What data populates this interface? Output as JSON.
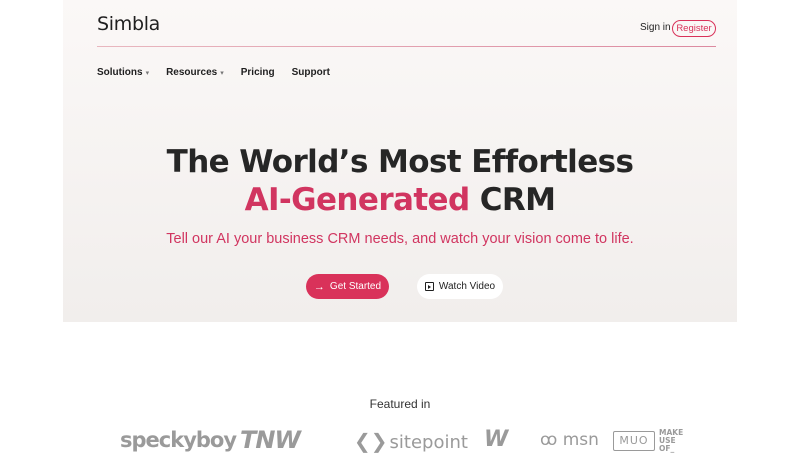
{
  "header": {
    "logo": "Simbla",
    "signin_label": "Sign in",
    "register_label": "Register"
  },
  "nav": {
    "items": [
      {
        "label": "Solutions",
        "has_dropdown": true
      },
      {
        "label": "Resources",
        "has_dropdown": true
      },
      {
        "label": "Pricing",
        "has_dropdown": false
      },
      {
        "label": "Support",
        "has_dropdown": false
      }
    ],
    "caret": "▾"
  },
  "hero": {
    "title_line1": "The World’s Most Effortless",
    "title_line2_accent": "AI-Generated",
    "title_line2_rest": " CRM",
    "subtitle": "Tell our AI your business CRM needs, and watch your vision come to life.",
    "primary_cta": "Get Started",
    "primary_cta_icon": "→",
    "secondary_cta": "Watch Video"
  },
  "featured": {
    "heading": "Featured in",
    "logos": {
      "speckyboy": "speckyboy",
      "tnw": "TNW",
      "sitepoint": "sitepoint",
      "sitepoint_glyph": "❮❯",
      "w": "W",
      "msn": "msn",
      "msn_glyph": "ꝏ",
      "muo_box": "MUO",
      "muo_text": "MAKE USE OF_"
    }
  },
  "colors": {
    "accent": "#d9325a",
    "text": "#1f1f1f",
    "logo_gray": "#9a9a9a",
    "hero_bg_top": "#fbf8f7",
    "hero_bg_bottom": "#f1eeec"
  }
}
